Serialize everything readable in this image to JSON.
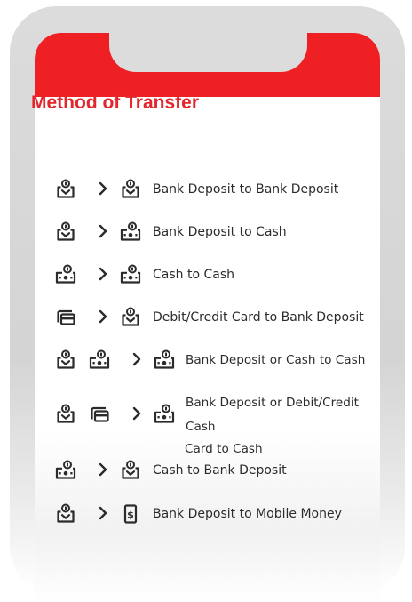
{
  "title": "Method of Transfer",
  "colors": {
    "brand_red": "#ee2024",
    "title_red": "#e3262b",
    "icon": "#2b2b2b"
  },
  "rows": [
    {
      "icons": [
        "bank-deposit-icon",
        "bank-deposit-icon"
      ],
      "label": "Bank Deposit to Bank Deposit"
    },
    {
      "icons": [
        "bank-deposit-icon",
        "cash-icon"
      ],
      "label": "Bank Deposit to Cash"
    },
    {
      "icons": [
        "cash-icon",
        "cash-icon"
      ],
      "label": "Cash to Cash"
    },
    {
      "icons": [
        "card-icon",
        "bank-deposit-icon"
      ],
      "label": "Debit/Credit Card to Bank Deposit"
    },
    {
      "icons": [
        "bank-deposit-icon",
        "cash-icon",
        "cash-icon"
      ],
      "label": "Bank Deposit or Cash to Cash"
    },
    {
      "icons": [
        "bank-deposit-icon",
        "card-icon",
        "cash-icon"
      ],
      "label_line1": "Bank Deposit or Debit/Credit",
      "label_line2": "Cash",
      "label_line3": "Card to Cash"
    },
    {
      "icons": [
        "cash-icon",
        "bank-deposit-icon"
      ],
      "label": "Cash to Bank Deposit"
    },
    {
      "icons": [
        "bank-deposit-icon",
        "mobile-money-icon"
      ],
      "label": "Bank Deposit to Mobile Money"
    }
  ]
}
